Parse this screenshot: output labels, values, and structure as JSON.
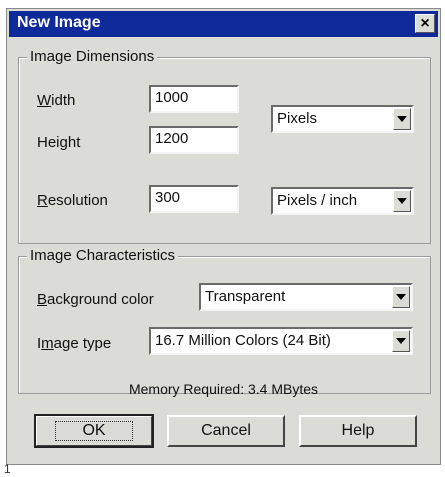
{
  "dialog": {
    "title": "New Image",
    "close_glyph": "×"
  },
  "dimensions": {
    "group_label": "Image Dimensions",
    "width_label": "Width",
    "width_value": "1000",
    "height_label": "Height",
    "height_value": "1200",
    "resolution_label": "Resolution",
    "resolution_value": "300",
    "units": "Pixels",
    "resolution_units": "Pixels / inch"
  },
  "characteristics": {
    "group_label": "Image Characteristics",
    "background_label": "Background color",
    "background_value": "Transparent",
    "type_label": "Image type",
    "type_value": "16.7 Million Colors (24 Bit)",
    "memory_text": "Memory Required: 3.4 MBytes"
  },
  "buttons": {
    "ok": "OK",
    "cancel": "Cancel",
    "help": "Help"
  },
  "footnote": "1",
  "colors": {
    "titlebar": "#0f2a9a",
    "dialog_bg": "#dcdcd6"
  },
  "icons": {
    "close": "close-icon",
    "dropdown": "chevron-down-icon"
  }
}
